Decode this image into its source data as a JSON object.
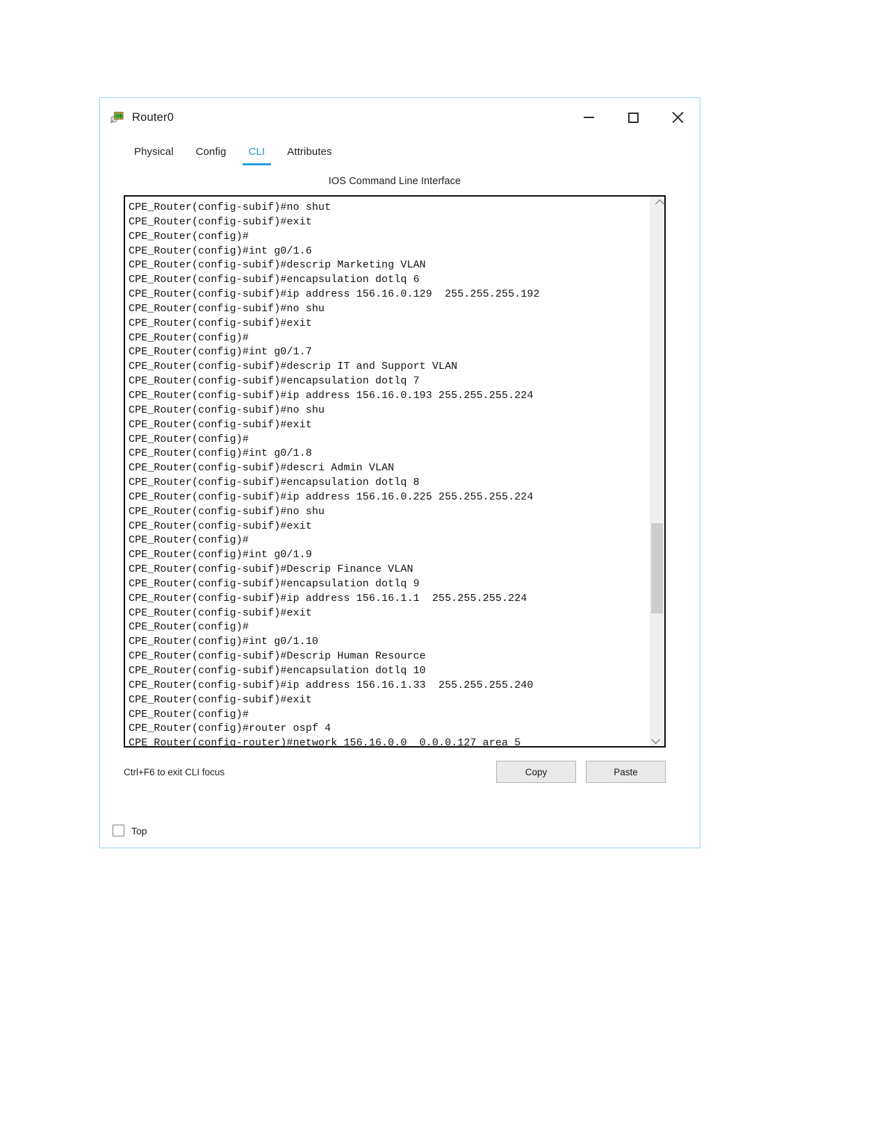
{
  "window": {
    "title": "Router0",
    "icon": "router-device-icon",
    "controls": {
      "minimize": "minimize-icon",
      "maximize": "maximize-icon",
      "close": "close-icon"
    }
  },
  "tabs": [
    {
      "label": "Physical",
      "active": false
    },
    {
      "label": "Config",
      "active": false
    },
    {
      "label": "CLI",
      "active": true
    },
    {
      "label": "Attributes",
      "active": false
    }
  ],
  "cli": {
    "header": "IOS Command Line Interface",
    "hint": "Ctrl+F6 to exit CLI focus",
    "copy_label": "Copy",
    "paste_label": "Paste",
    "lines": [
      "CPE_Router(config-subif)#no shut",
      "CPE_Router(config-subif)#exit",
      "CPE_Router(config)#",
      "CPE_Router(config)#int g0/1.6",
      "CPE_Router(config-subif)#descrip Marketing VLAN",
      "CPE_Router(config-subif)#encapsulation dotlq 6",
      "CPE_Router(config-subif)#ip address 156.16.0.129  255.255.255.192",
      "CPE_Router(config-subif)#no shu",
      "CPE_Router(config-subif)#exit",
      "CPE_Router(config)#",
      "CPE_Router(config)#int g0/1.7",
      "CPE_Router(config-subif)#descrip IT and Support VLAN",
      "CPE_Router(config-subif)#encapsulation dotlq 7",
      "CPE_Router(config-subif)#ip address 156.16.0.193 255.255.255.224",
      "CPE_Router(config-subif)#no shu",
      "CPE_Router(config-subif)#exit",
      "CPE_Router(config)#",
      "CPE_Router(config)#int g0/1.8",
      "CPE_Router(config-subif)#descri Admin VLAN",
      "CPE_Router(config-subif)#encapsulation dotlq 8",
      "CPE_Router(config-subif)#ip address 156.16.0.225 255.255.255.224",
      "CPE_Router(config-subif)#no shu",
      "CPE_Router(config-subif)#exit",
      "CPE_Router(config)#",
      "CPE_Router(config)#int g0/1.9",
      "CPE_Router(config-subif)#Descrip Finance VLAN",
      "CPE_Router(config-subif)#encapsulation dotlq 9",
      "CPE_Router(config-subif)#ip address 156.16.1.1  255.255.255.224",
      "CPE_Router(config-subif)#exit",
      "CPE_Router(config)#",
      "CPE_Router(config)#int g0/1.10",
      "CPE_Router(config-subif)#Descrip Human Resource",
      "CPE_Router(config-subif)#encapsulation dotlq 10",
      "CPE_Router(config-subif)#ip address 156.16.1.33  255.255.255.240",
      "CPE_Router(config-subif)#exit",
      "CPE_Router(config)#",
      "CPE_Router(config)#router ospf 4",
      "CPE_Router(config-router)#network 156.16.0.0  0.0.0.127 area 5"
    ]
  },
  "footer": {
    "top_label": "Top",
    "top_checked": false
  },
  "colors": {
    "accent": "#22a0dd",
    "window_border": "#9fd2ef",
    "terminal_border": "#0a0a0a",
    "scrollbar_track": "#f0f0f0",
    "scrollbar_thumb": "#cdcdcd",
    "button_face": "#e9e9e9"
  }
}
